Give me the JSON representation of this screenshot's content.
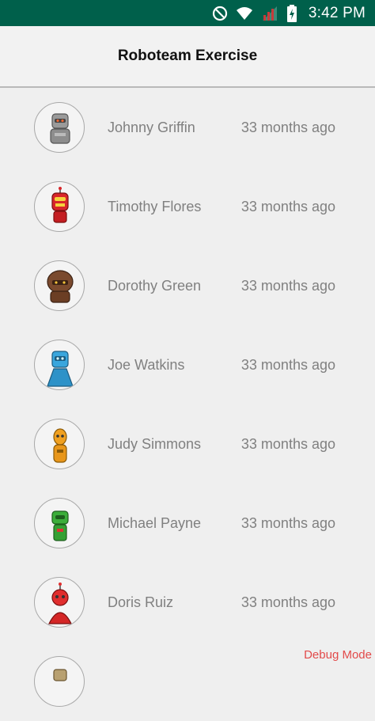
{
  "status_bar": {
    "time": "3:42 PM",
    "icons": [
      "do-not-disturb-icon",
      "wifi-icon",
      "signal-off-icon",
      "battery-charging-icon"
    ]
  },
  "app_bar": {
    "title": "Roboteam Exercise"
  },
  "users": [
    {
      "name": "Johnny Griffin",
      "time": "33 months ago",
      "avatar_color": "#9a9a9a"
    },
    {
      "name": "Timothy Flores",
      "time": "33 months ago",
      "avatar_color": "#d8262a"
    },
    {
      "name": "Dorothy Green",
      "time": "33 months ago",
      "avatar_color": "#7a4a2e"
    },
    {
      "name": "Joe Watkins",
      "time": "33 months ago",
      "avatar_color": "#3aa6dd"
    },
    {
      "name": "Judy Simmons",
      "time": "33 months ago",
      "avatar_color": "#f0a020"
    },
    {
      "name": "Michael Payne",
      "time": "33 months ago",
      "avatar_color": "#3cae3a"
    },
    {
      "name": "Doris Ruiz",
      "time": "33 months ago",
      "avatar_color": "#e02e2e"
    }
  ],
  "debug_label": "Debug Mode",
  "colors": {
    "status_bar": "#00604b",
    "secondary_text": "#808080",
    "debug_text": "#e24a4a"
  }
}
